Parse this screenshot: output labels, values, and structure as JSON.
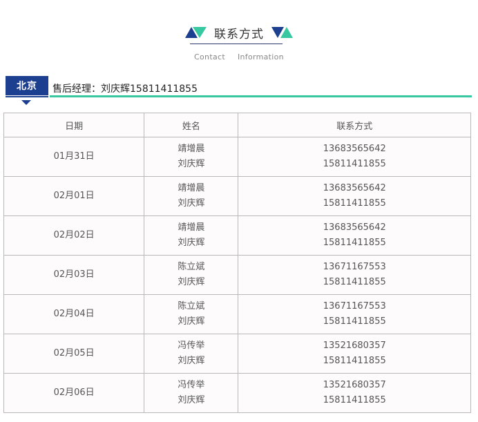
{
  "header": {
    "title": "联系方式",
    "subtitle_left": "Contact",
    "subtitle_right": "Information",
    "colors": {
      "navy": "#1d3f8f",
      "teal": "#37c8a1"
    }
  },
  "section": {
    "city": "北京",
    "manager": "售后经理：刘庆辉15811411855"
  },
  "table": {
    "headers": [
      "日期",
      "姓名",
      "联系方式"
    ],
    "rows": [
      {
        "date": "01月31日",
        "names": [
          "靖增晨",
          "刘庆辉"
        ],
        "phones": [
          "13683565642",
          "15811411855"
        ]
      },
      {
        "date": "02月01日",
        "names": [
          "靖增晨",
          "刘庆辉"
        ],
        "phones": [
          "13683565642",
          "15811411855"
        ]
      },
      {
        "date": "02月02日",
        "names": [
          "靖增晨",
          "刘庆辉"
        ],
        "phones": [
          "13683565642",
          "15811411855"
        ]
      },
      {
        "date": "02月03日",
        "names": [
          "陈立斌",
          "刘庆辉"
        ],
        "phones": [
          "13671167553",
          "15811411855"
        ]
      },
      {
        "date": "02月04日",
        "names": [
          "陈立斌",
          "刘庆辉"
        ],
        "phones": [
          "13671167553",
          "15811411855"
        ]
      },
      {
        "date": "02月05日",
        "names": [
          "冯传举",
          "刘庆辉"
        ],
        "phones": [
          "13521680357",
          "15811411855"
        ]
      },
      {
        "date": "02月06日",
        "names": [
          "冯传举",
          "刘庆辉"
        ],
        "phones": [
          "13521680357",
          "15811411855"
        ]
      }
    ]
  }
}
